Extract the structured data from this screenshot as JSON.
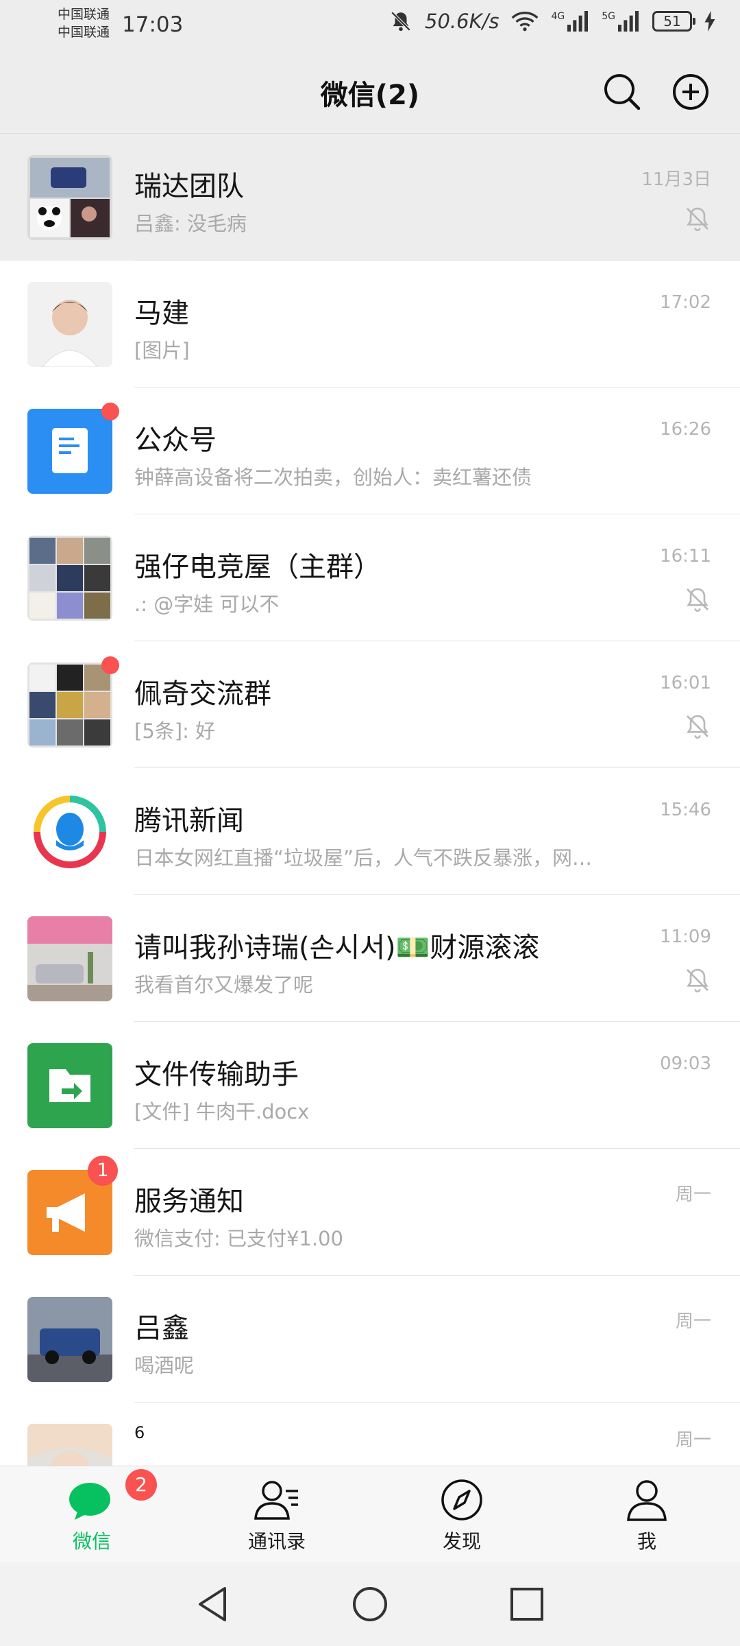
{
  "status_bar": {
    "carrier_1": "中国联通",
    "carrier_2": "中国联通",
    "time": "17:03",
    "net_speed": "50.6K/s",
    "net_1": "4G",
    "net_2": "5G",
    "battery": "51"
  },
  "header": {
    "title": "微信(2)",
    "search_icon": "search-icon",
    "add_icon": "plus-circle-icon"
  },
  "chats": [
    {
      "name": "瑞达团队",
      "preview": "吕鑫: 没毛病",
      "time": "11月3日",
      "muted": true,
      "pinned": true
    },
    {
      "name": "马建",
      "preview": "[图片]",
      "time": "17:02",
      "muted": false
    },
    {
      "name": "公众号",
      "preview": "钟薛高设备将二次拍卖，创始人：卖红薯还债",
      "time": "16:26",
      "muted": false,
      "dot": true
    },
    {
      "name": "强仔电竞屋（主群）",
      "preview": ".: @字娃 可以不",
      "time": "16:11",
      "muted": true
    },
    {
      "name": "佩奇交流群",
      "preview": "[5条]: 好",
      "time": "16:01",
      "muted": true,
      "dot": true
    },
    {
      "name": "腾讯新闻",
      "preview": "日本女网红直播“垃圾屋”后，人气不跌反暴涨，网…",
      "time": "15:46",
      "muted": false
    },
    {
      "name": "请叫我孙诗瑞(손시서)💵财源滚滚",
      "preview": "我看首尔又爆发了呢",
      "time": "11:09",
      "muted": true
    },
    {
      "name": "文件传输助手",
      "preview": "[文件] 牛肉干.docx",
      "time": "09:03",
      "muted": false
    },
    {
      "name": "服务通知",
      "preview": "微信支付: 已支付¥1.00",
      "time": "周一",
      "muted": false,
      "badge": "1"
    },
    {
      "name": "吕鑫",
      "preview": "喝酒呢",
      "time": "周一",
      "muted": false
    },
    {
      "name": "6",
      "preview": "",
      "time": "周一",
      "muted": false
    }
  ],
  "bottom_nav": [
    {
      "label": "微信",
      "icon": "chat-bubble-icon",
      "badge": "2",
      "active": true
    },
    {
      "label": "通讯录",
      "icon": "contacts-icon"
    },
    {
      "label": "发现",
      "icon": "compass-icon"
    },
    {
      "label": "我",
      "icon": "person-icon"
    }
  ],
  "colors": {
    "accent": "#07c160",
    "badge": "#fa5151",
    "header_bg": "#ededed"
  }
}
